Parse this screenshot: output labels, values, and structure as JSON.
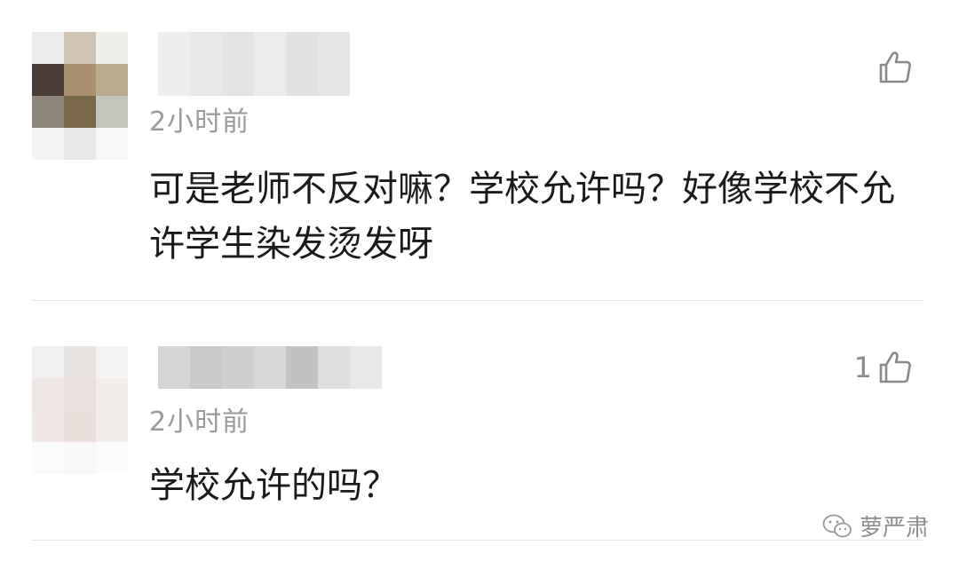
{
  "comments": [
    {
      "avatar_colors": [
        "#ebebeb",
        "#cfc3b4",
        "#f1efe9",
        "#4a3d38",
        "#a98f6b",
        "#b9ab8b",
        "#8e877b",
        "#7b6848",
        "#c4c5bc",
        "#f4f4f4",
        "#e9e9e9",
        "#f7f7f5"
      ],
      "name_colors": [
        "#efefef",
        "#e9e9e9",
        "#e4e4e4",
        "#ececec",
        "#e2e2e2",
        "#e6e6e6"
      ],
      "time": "2小时前",
      "text": "可是老师不反对嘛？学校允许吗？好像学校不允许学生染发烫发呀",
      "likes": ""
    },
    {
      "avatar_colors": [
        "#f1f0f0",
        "#e8e4e2",
        "#f4f3f2",
        "#efe6e6",
        "#ece1e0",
        "#f2ecea",
        "#f1e7e4",
        "#eadfda",
        "#f3eeec",
        "#fafafa",
        "#f7f7f7",
        "#fbfbfb"
      ],
      "name_colors": [
        "#d4d4d4",
        "#c9c9c9",
        "#cecece",
        "#d7d7d7",
        "#c2c2c2",
        "#dedede",
        "#e8e8e8"
      ],
      "time": "2小时前",
      "text": "学校允许的吗？",
      "likes": "1"
    }
  ],
  "icons": {
    "like": "thumbs-up-icon",
    "watermark": "wechat-icon"
  },
  "watermark": {
    "text": "萝严肃"
  }
}
